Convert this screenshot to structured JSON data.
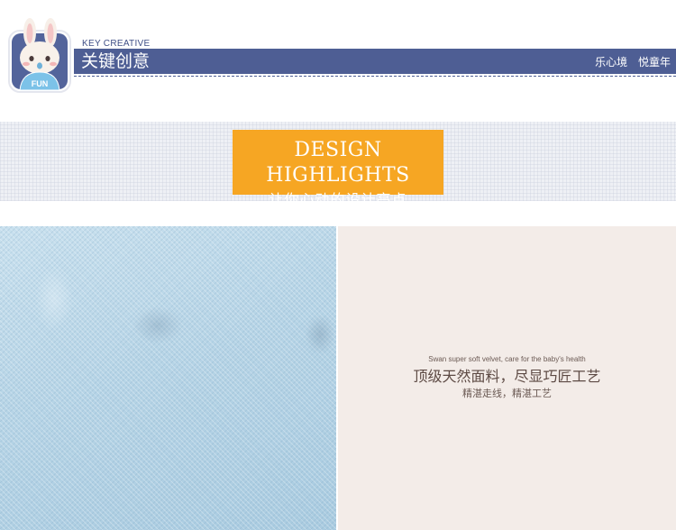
{
  "header": {
    "kicker": "KEY CREATIVE",
    "title": "关键创意",
    "tagline_left": "乐心境",
    "tagline_right": "悦童年",
    "logo_text": "FUN",
    "accent_color": "#4e5e94"
  },
  "highlight": {
    "title": "DESIGN HIGHLIGHTS",
    "subtitle": "让你心动的设计亮点",
    "badge_color": "#f6a623"
  },
  "feature": {
    "english": "Swan super soft velvet, care for the baby's health",
    "title": "顶级天然面料，尽显巧匠工艺",
    "subtitle": "精湛走线，精湛工艺",
    "panel_color": "#f3ece8"
  }
}
